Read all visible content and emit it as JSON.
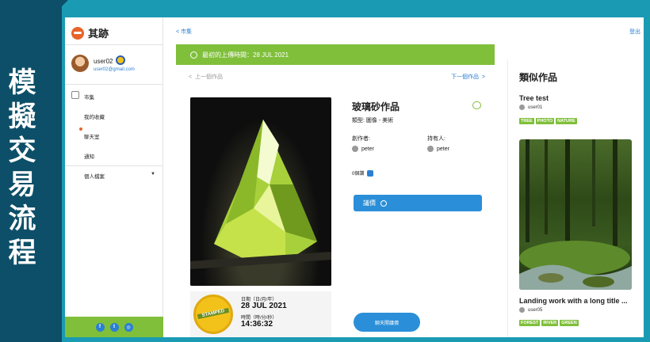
{
  "caption": "模擬交易流程",
  "sidebar": {
    "brand": "其跡",
    "user_name": "user02",
    "user_email": "user02@gmail.com",
    "nav": [
      "市集",
      "我的收藏",
      "聊天室",
      "通知"
    ],
    "profile": "個人檔案",
    "social": [
      "f",
      "t",
      "◎"
    ]
  },
  "main": {
    "back": "市集",
    "banner": "最初的上傳時間：28 JUL 2021",
    "prev": "上一個作品",
    "next": "下一個作品",
    "title": "玻璃砂作品",
    "type_line": "類型: 圖像 - 美術",
    "creator_label": "創作者:",
    "creator": "peter",
    "holder_label": "持有人:",
    "holder": "peter",
    "likes": "0個讚",
    "bid": "議價",
    "chat": "聊天開議價",
    "stamp": "STAMPED",
    "date_label": "日期（日/月/年）",
    "date": "28 JUL 2021",
    "time_label": "時間（時/分/秒）",
    "time": "14:36:32"
  },
  "right": {
    "logout": "登出",
    "title": "類似作品",
    "card1_title": "Tree test",
    "card1_user": "user01",
    "card1_tags": [
      "TREE",
      "PHOTO",
      "NATURE"
    ],
    "card2_title": "Landing work with a long title ...",
    "card2_user": "user05",
    "card2_tags": [
      "FOREST",
      "RIVER",
      "GREEN"
    ]
  },
  "colors": {
    "accent_green": "#7fbf3a",
    "accent_blue": "#2a8fd8",
    "banner_dark": "#0d4f68",
    "frame_teal": "#1a9bb3"
  }
}
